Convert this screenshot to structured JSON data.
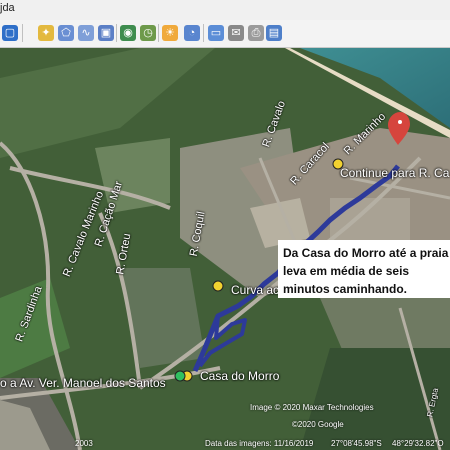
{
  "menu": {
    "text": "jda"
  },
  "toolbar": {
    "icons": [
      "square-icon",
      "star-pin-icon",
      "polygon-icon",
      "path-icon",
      "overlay-icon",
      "tour-icon",
      "historical-imagery-icon",
      "sun-icon",
      "planet-icon",
      "ruler-icon",
      "email-icon",
      "print-icon",
      "save-image-icon",
      "maps-icon"
    ]
  },
  "callout": {
    "line1": "Da Casa do Morro até a praia",
    "line2": "leva em média de seis",
    "line3": "minutos caminhando."
  },
  "map": {
    "streets": {
      "r_calvalo_marinho": "R. Cavalo Marinho",
      "r_coquil": "R. Coquil",
      "r_cacao_mar": "R. Cação Mar",
      "r_orteu": "R. Orteu",
      "r_caracol": "R. Caracol",
      "r_marinho_jo": "R. Marinho",
      "r_cavalo_jo": "R. Cavalo",
      "r_erg": "R. Ergta",
      "r_coquilaco": "R. Coquil",
      "r_sardinha": "R. Sardinha"
    },
    "waypoints": {
      "continue": "Continue para R. Ca",
      "curva": "Curva acen",
      "destination": "Casa do Morro",
      "start": "o a Av. Ver. Manoel dos Santos"
    },
    "attribution": {
      "image_credit": "Image © 2020 Maxar Technologies",
      "google": "©2020 Google",
      "year": "2003",
      "imagery_date": "Data das imagens: 11/16/2019",
      "latitude": "27°08'45.98\"S",
      "longitude": "48°29'32.82\"O"
    }
  }
}
